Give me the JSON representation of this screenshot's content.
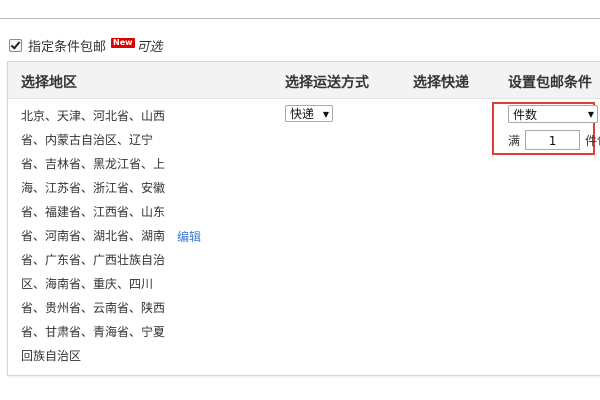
{
  "option": {
    "label": "指定条件包邮",
    "checked": true,
    "badge": "New",
    "note": "可选"
  },
  "table": {
    "headers": [
      "选择地区",
      "选择运送方式",
      "选择快递",
      "设置包邮条件"
    ],
    "regions_lines": [
      "北京、天津、河北省、山西",
      "省、内蒙古自治区、辽宁",
      "省、吉林省、黑龙江省、上",
      "海、江苏省、浙江省、安徽",
      "省、福建省、江西省、山东",
      "省、河南省、湖北省、湖南",
      "省、广东省、广西壮族自治",
      "区、海南省、重庆、四川",
      "省、贵州省、云南省、陕西",
      "省、甘肃省、青海省、宁夏",
      "回族自治区"
    ],
    "edit_label": "编辑",
    "shipping_method": "快递",
    "condition_type": "件数",
    "condition_prefix": "满",
    "condition_value": "1",
    "condition_suffix": "件包"
  },
  "colors": {
    "highlight": "#e33a3a",
    "link": "#3a7bd5",
    "badge": "#e00000"
  }
}
